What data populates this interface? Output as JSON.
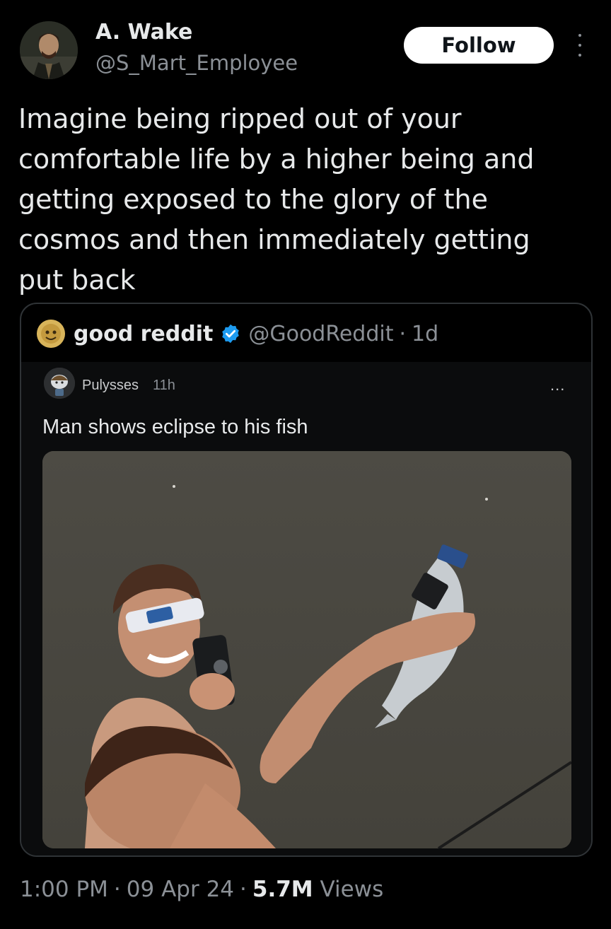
{
  "author": {
    "name": "A. Wake",
    "handle": "@S_Mart_Employee",
    "follow_label": "Follow"
  },
  "tweet": {
    "text": "Imagine being ripped out of your\ncomfortable life by a higher being and\ngetting exposed to the glory of the\ncosmos and then immediately getting\nput back"
  },
  "quote": {
    "name": "good reddit",
    "handle": "@GoodReddit",
    "separator": "·",
    "age": "1d",
    "reddit_post": {
      "user": "Pulysses",
      "time": "11h",
      "more": "...",
      "title": "Man shows eclipse to his fish"
    }
  },
  "meta": {
    "time": "1:00 PM",
    "date": "09 Apr 24",
    "separator": "·",
    "views_count": "5.7M",
    "views_label": "Views"
  },
  "colors": {
    "background": "#000000",
    "text_primary": "#e7e9ea",
    "text_secondary": "#8b9096",
    "verified_badge": "#1d9bf0",
    "follow_button_bg": "#ffffff"
  },
  "icons": [
    "more-options-icon",
    "verified-badge-icon"
  ]
}
